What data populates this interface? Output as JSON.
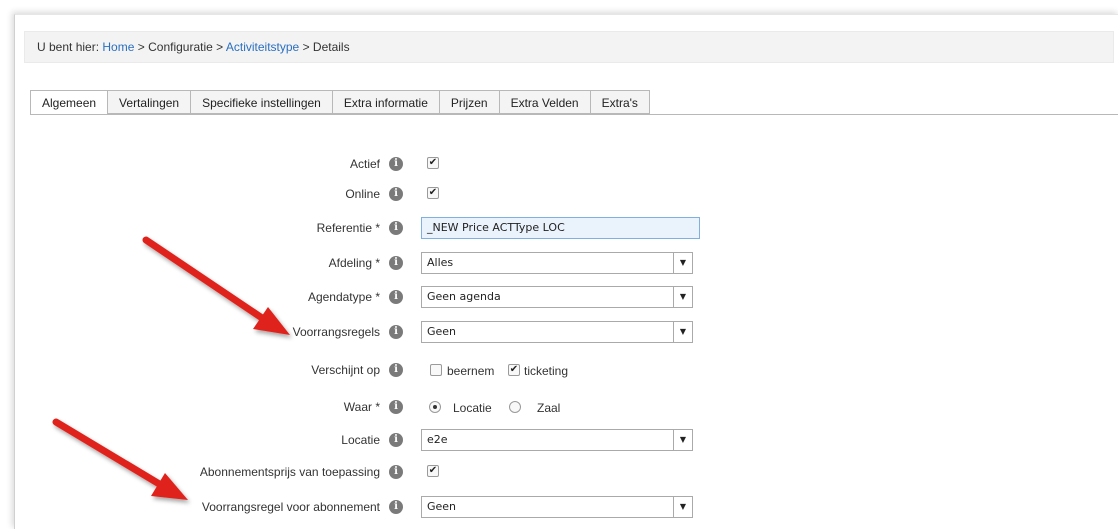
{
  "breadcrumb": {
    "prefix": "U bent hier:",
    "home": "Home",
    "sep1": ">",
    "config": "Configuratie",
    "sep2": ">",
    "acttype": "Activiteitstype",
    "sep3": ">",
    "current": "Details"
  },
  "tabs": [
    "Algemeen",
    "Vertalingen",
    "Specifieke instellingen",
    "Extra informatie",
    "Prijzen",
    "Extra Velden",
    "Extra's"
  ],
  "form": {
    "actief": {
      "label": "Actief",
      "checked": true
    },
    "online": {
      "label": "Online",
      "checked": true
    },
    "referentie": {
      "label": "Referentie *",
      "value": "_NEW Price ACTType LOC"
    },
    "afdeling": {
      "label": "Afdeling *",
      "value": "Alles"
    },
    "agendatype": {
      "label": "Agendatype *",
      "value": "Geen agenda"
    },
    "voorrangsregels": {
      "label": "Voorrangsregels",
      "value": "Geen"
    },
    "verschijnt_op": {
      "label": "Verschijnt op",
      "options": [
        {
          "label": "beernem",
          "checked": false
        },
        {
          "label": "ticketing",
          "checked": true
        }
      ]
    },
    "waar": {
      "label": "Waar *",
      "options": [
        {
          "label": "Locatie",
          "selected": true
        },
        {
          "label": "Zaal",
          "selected": false
        }
      ]
    },
    "locatie": {
      "label": "Locatie",
      "value": "e2e"
    },
    "abonnementsprijs": {
      "label": "Abonnementsprijs van toepassing",
      "checked": true
    },
    "voorrangsregel_abonnement": {
      "label": "Voorrangsregel voor abonnement",
      "value": "Geen"
    }
  },
  "icons": {
    "info": "info-icon",
    "caret": "chevron-down-icon",
    "check": "checkmark-icon"
  },
  "colors": {
    "link": "#2a6fc0",
    "annotation_arrow": "#e0241b",
    "field_highlight": "#eaf3fc"
  }
}
